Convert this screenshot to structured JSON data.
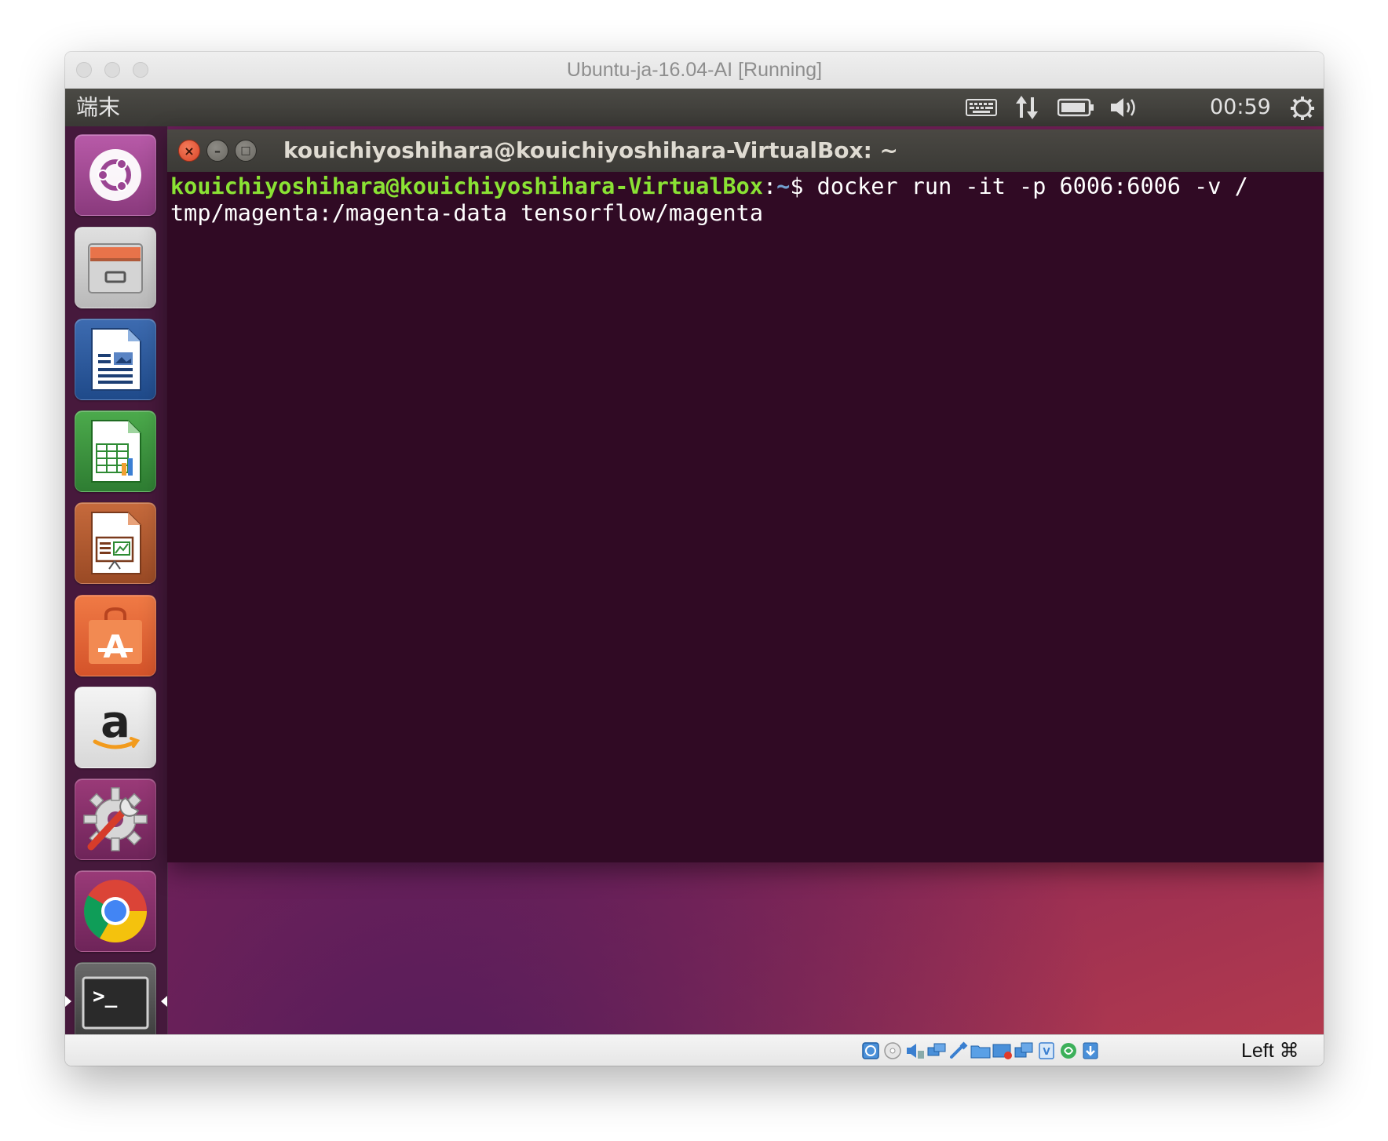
{
  "window": {
    "title": "Ubuntu-ja-16.04-AI [Running]"
  },
  "panel": {
    "app_name": "端末",
    "clock": "00:59",
    "icons": [
      "keyboard-icon",
      "network-icon",
      "battery-icon",
      "volume-icon",
      "power-icon"
    ]
  },
  "launcher": {
    "items": [
      {
        "name": "ubuntu-dash",
        "icon": "ubuntu-logo-icon"
      },
      {
        "name": "files",
        "icon": "file-cabinet-icon"
      },
      {
        "name": "libreoffice-writer",
        "icon": "writer-document-icon"
      },
      {
        "name": "libreoffice-calc",
        "icon": "calc-spreadsheet-icon"
      },
      {
        "name": "libreoffice-impress",
        "icon": "impress-presentation-icon"
      },
      {
        "name": "ubuntu-software",
        "icon": "software-bag-icon",
        "glyph": "A"
      },
      {
        "name": "amazon",
        "icon": "amazon-icon",
        "glyph": "a"
      },
      {
        "name": "system-settings",
        "icon": "settings-gear-wrench-icon"
      },
      {
        "name": "google-chrome",
        "icon": "chrome-icon"
      },
      {
        "name": "terminal",
        "icon": "terminal-icon",
        "glyph": ">_",
        "active": true
      }
    ]
  },
  "terminal": {
    "title": "kouichiyoshihara@kouichiyoshihara-VirtualBox: ~",
    "prompt_user": "kouichiyoshihara@kouichiyoshihara-VirtualBox",
    "prompt_sep": ":",
    "prompt_path": "~",
    "prompt_symbol": "$ ",
    "command_line1": "docker run -it -p 6006:6006 -v /",
    "command_line2": "tmp/magenta:/magenta-data tensorflow/magenta",
    "close_glyph": "×",
    "minimize_glyph": "–",
    "maximize_glyph": "□"
  },
  "colors": {
    "terminal_bg": "#300a24",
    "prompt_user": "#8ae234",
    "prompt_path": "#729fcf",
    "accent_orange": "#e05b2e"
  },
  "statusbar": {
    "host_key": "Left ⌘",
    "icons": [
      "hard-disk-icon",
      "optical-disk-icon",
      "audio-icon",
      "network-adapter-icon",
      "usb-icon",
      "shared-folder-icon",
      "display-icon",
      "recording-icon",
      "drag-drop-icon",
      "cpu-icon",
      "mouse-integration-icon",
      "arrow-down-icon"
    ]
  }
}
